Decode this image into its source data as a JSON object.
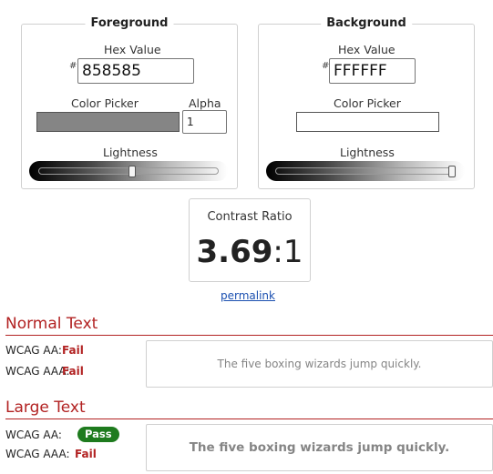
{
  "foreground": {
    "legend": "Foreground",
    "hex_label": "Hex Value",
    "hex_prefix": "#",
    "hex_value": "858585",
    "picker_label": "Color Picker",
    "alpha_label": "Alpha",
    "alpha_value": "1",
    "lightness_label": "Lightness",
    "color": "#858585",
    "lightness_fraction": 0.52
  },
  "background": {
    "legend": "Background",
    "hex_label": "Hex Value",
    "hex_prefix": "#",
    "hex_value": "FFFFFF",
    "picker_label": "Color Picker",
    "lightness_label": "Lightness",
    "color": "#FFFFFF",
    "lightness_fraction": 1.0
  },
  "contrast": {
    "label": "Contrast Ratio",
    "value": "3.69",
    "suffix": ":1"
  },
  "permalink": "permalink",
  "normal_text": {
    "heading": "Normal Text",
    "aa_label": "WCAG AA:",
    "aa_result": "Fail",
    "aaa_label": "WCAG AAA:",
    "aaa_result": "Fail",
    "sample": "The five boxing wizards jump quickly."
  },
  "large_text": {
    "heading": "Large Text",
    "aa_label": "WCAG AA:",
    "aa_result": "Pass",
    "aaa_label": "WCAG AAA:",
    "aaa_result": "Fail",
    "sample": "The five boxing wizards jump quickly."
  },
  "colors": {
    "fail": "#b22222",
    "pass": "#1e7b1e",
    "link": "#1a4fb0"
  }
}
